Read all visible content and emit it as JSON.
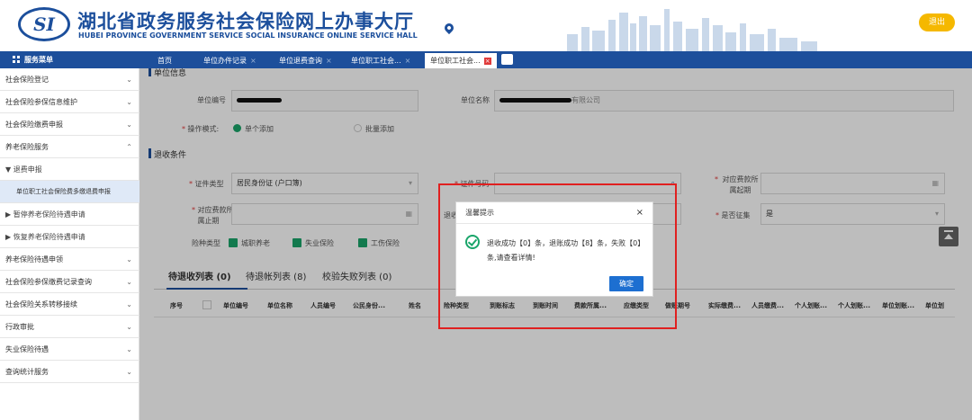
{
  "header": {
    "logo_text": "SI",
    "title": "湖北省政务服务社会保险网上办事大厅",
    "subtitle": "HUBEI PROVINCE GOVERNMENT SERVICE SOCIAL INSURANCE ONLINE SERVICE HALL",
    "logout": "退出"
  },
  "nav": {
    "menu_title": "服务菜单",
    "tabs": [
      {
        "label": "首页"
      },
      {
        "label": "单位办件记录"
      },
      {
        "label": "单位退费查询"
      },
      {
        "label": "单位职工社会..."
      },
      {
        "label": "单位职工社会..."
      }
    ]
  },
  "sidebar": {
    "items": [
      {
        "label": "社会保险登记"
      },
      {
        "label": "社会保险参保信息维护"
      },
      {
        "label": "社会保险缴费申报"
      },
      {
        "label": "养老保险服务"
      },
      {
        "label": "▼ 退费申报"
      },
      {
        "label": "单位职工社会保险费多缴退费申报"
      },
      {
        "label": "▶ 暂停养老保险待遇申请"
      },
      {
        "label": "▶ 恢复养老保险待遇申请"
      },
      {
        "label": "养老保险待遇申领"
      },
      {
        "label": "社会保险参保缴费记录查询"
      },
      {
        "label": "社会保险关系转移接续"
      },
      {
        "label": "行政审批"
      },
      {
        "label": "失业保险待遇"
      },
      {
        "label": "查询统计服务"
      }
    ]
  },
  "form": {
    "section1": "单位信息",
    "unit_no_label": "单位编号",
    "unit_name_label": "单位名称",
    "unit_name_value": "有限公司",
    "op_mode_label": "操作模式:",
    "op_single": "单个添加",
    "op_batch": "批量添加",
    "section2": "退收条件",
    "id_type_label": "证件类型",
    "id_type_value": "居民身份证 (户口簿)",
    "id_no_label": "证件号码",
    "period_start_label": "对应费款所属起期",
    "period_end_label": "对应费款所属止期",
    "refund_label": "退收",
    "is_levy_label": "是否征集",
    "is_levy_value": "是",
    "insurance_type_label": "险种类型",
    "ins1": "城职养老",
    "ins2": "失业保险",
    "ins3": "工伤保险"
  },
  "list_tabs": [
    {
      "label": "待退收列表 (0)"
    },
    {
      "label": "待退帐列表 (8)"
    },
    {
      "label": "校验失败列表 (0)"
    }
  ],
  "table": {
    "headers": [
      "序号",
      "单位编号",
      "单位名称",
      "人员编号",
      "公民身份...",
      "姓名",
      "险种类型",
      "到账标志",
      "到账时间",
      "费款所属...",
      "应缴类型",
      "做账期号",
      "实际缴费...",
      "人员缴费...",
      "个人划账...",
      "个人划账...",
      "单位划账...",
      "单位划"
    ]
  },
  "dialog": {
    "title": "温馨提示",
    "message": "退收成功【0】条，退账成功【8】条，失败【0】条,请查看详情!",
    "ok": "确定",
    "close": "×"
  },
  "colors": {
    "primary": "#1d4f9b",
    "success": "#1aa56a",
    "warning": "#f5b800",
    "highlight": "#e02020"
  }
}
